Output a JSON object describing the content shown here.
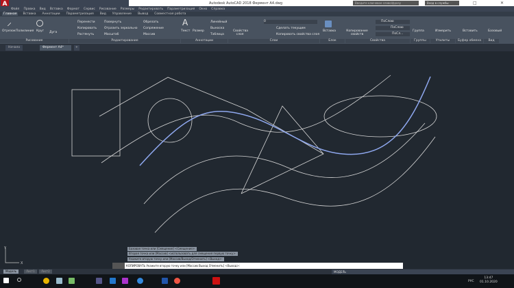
{
  "app": {
    "title": "Autodesk AutoCAD 2018  Фермент А4.dwg",
    "search_placeholder": "Введите ключевое слово/фразу",
    "signin": "Вход в службы"
  },
  "menu": [
    "Файл",
    "Правка",
    "Вид",
    "Вставка",
    "Формат",
    "Сервис",
    "Рисование",
    "Размеры",
    "Редактировать",
    "Параметризация",
    "Окно",
    "Справка"
  ],
  "ribbon_tabs": [
    "Главная",
    "Вставка",
    "Аннотации",
    "Параметризация",
    "Вид",
    "Управление",
    "Вывод",
    "Совместная работа"
  ],
  "ribbon": {
    "draw": {
      "title": "Рисование",
      "items": [
        "Отрезок",
        "Полилиния",
        "Круг",
        "Дуга"
      ]
    },
    "modify": {
      "title": "Редактирование",
      "items": [
        "Перенести",
        "Копировать",
        "Растянуть",
        "Повернуть",
        "Отразить зеркально",
        "Масштаб",
        "Обрезать",
        "Сопряжение",
        "Массив"
      ]
    },
    "annotation": {
      "title": "Аннотации",
      "items": [
        "Текст",
        "Размер",
        "Линейный",
        "Выноска",
        "Таблица"
      ]
    },
    "layers": {
      "title": "Слои",
      "items": [
        "Свойства слоя",
        "Сделать текущим",
        "Копировать свойства слоя"
      ],
      "current": "0"
    },
    "block": {
      "title": "Блок",
      "items": [
        "Вставка"
      ]
    },
    "properties": {
      "title": "Свойства",
      "items": [
        "Копирование свойств",
        "ПоСлою",
        "ПоСлою",
        "ПоСл..."
      ]
    },
    "groups": {
      "title": "Группы",
      "items": [
        "Группа"
      ]
    },
    "utilities": {
      "title": "Утилиты",
      "items": [
        "Измерить"
      ]
    },
    "clipboard": {
      "title": "Буфер обмена",
      "items": [
        "Вставить"
      ]
    },
    "view": {
      "title": "Вид",
      "items": [
        "Базовый"
      ]
    }
  },
  "file_tabs": [
    "Начало",
    "Фермент А4*"
  ],
  "command_history": [
    "Базовая точка или [Смещение] <Смещение>:",
    "Вторая точка или [Массив] <использовать для смещения первую точку>:",
    "Укажите вторую точку или [Массив/Выход/Отменить] <Выход>:"
  ],
  "command_input": "КОПИРОВАТЬ Укажите вторую точку или [Массив Выход Отменить] <Выход>:",
  "layout_tabs": [
    "Модель",
    "Лист1",
    "Лист2"
  ],
  "status": {
    "mode": "МОДЕЛЬ"
  },
  "taskbar": {
    "lang": "РУС",
    "time": "13:47",
    "date": "01.10.2020"
  },
  "ucs": {
    "x": "X",
    "y": "Y"
  },
  "colors": {
    "canvas": "#212830",
    "spline": "#8fa8ef",
    "lines": "#d8d8d8",
    "accent": "#b3141b"
  }
}
